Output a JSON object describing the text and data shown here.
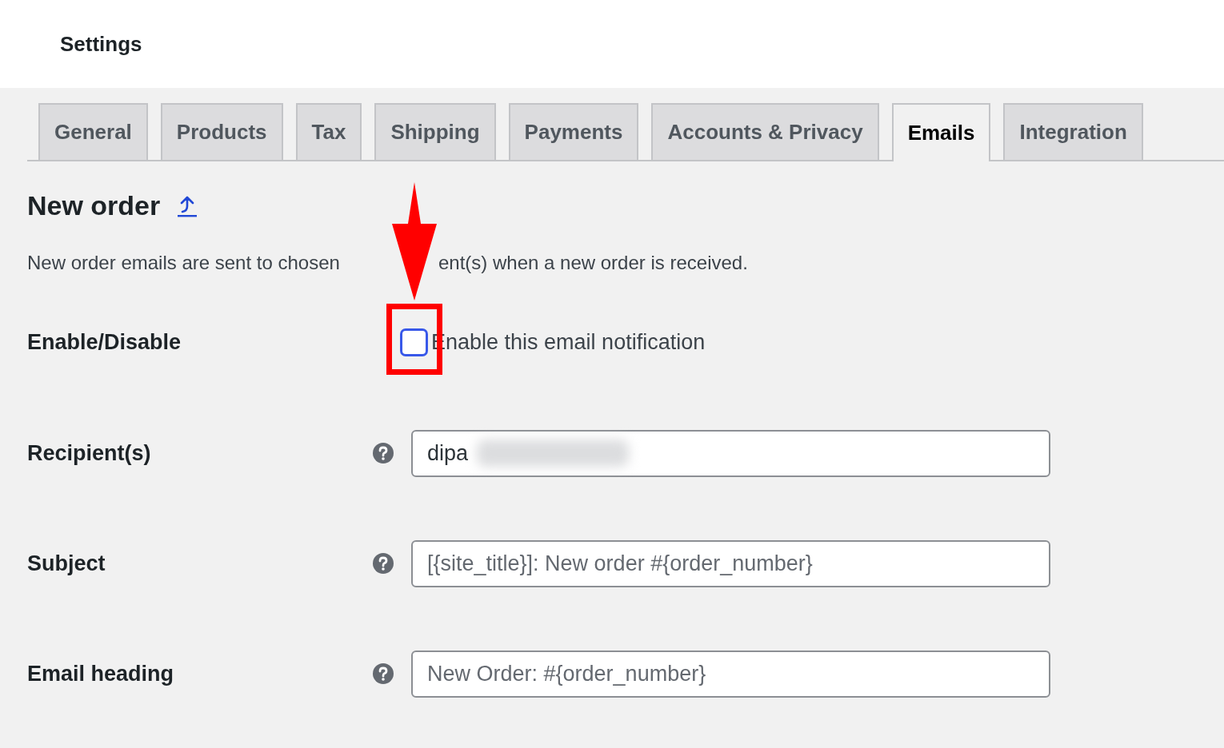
{
  "page_title": "Settings",
  "tabs": [
    {
      "label": "General",
      "selected": false
    },
    {
      "label": "Products",
      "selected": false
    },
    {
      "label": "Tax",
      "selected": false
    },
    {
      "label": "Shipping",
      "selected": false
    },
    {
      "label": "Payments",
      "selected": false
    },
    {
      "label": "Accounts & Privacy",
      "selected": false
    },
    {
      "label": "Emails",
      "selected": true
    },
    {
      "label": "Integration",
      "selected": false
    }
  ],
  "section": {
    "title": "New order",
    "description_parts": [
      "New order emails are sent to chosen",
      "ent(s) when a new order is received."
    ]
  },
  "enable": {
    "label": "Enable/Disable",
    "checkbox_label": "Enable this email notification",
    "checked": false
  },
  "fields": [
    {
      "label": "Recipient(s)",
      "value": "dipa",
      "redacted": true
    },
    {
      "label": "Subject",
      "placeholder": "[{site_title}]: New order #{order_number}"
    },
    {
      "label": "Email heading",
      "placeholder": "New Order: #{order_number}"
    }
  ]
}
